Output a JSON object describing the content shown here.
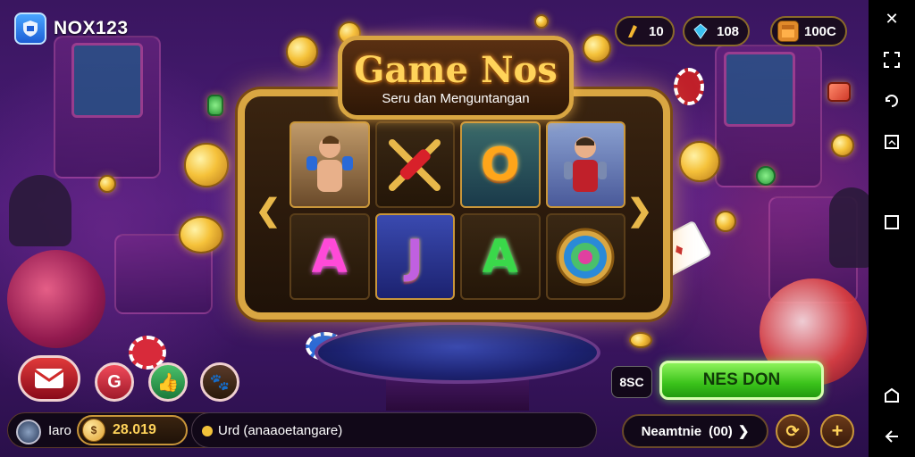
{
  "app": {
    "logo_text": "NOX123",
    "logo_icon": "shield-icon"
  },
  "currencies": [
    {
      "icon": "key-icon",
      "value": "10",
      "color": "#f2b531"
    },
    {
      "icon": "gem-icon",
      "value": "108",
      "color": "#3ac0f0"
    },
    {
      "icon": "chest-icon",
      "value": "100C",
      "color": "#e08a2a"
    }
  ],
  "game": {
    "title": "Game Nos",
    "subtitle": "Seru dan Menguntangan",
    "reels": [
      {
        "symbol": "hero-boxer-card",
        "text": ""
      },
      {
        "symbol": "crossed-bat-icon",
        "text": ""
      },
      {
        "symbol": "letter-o",
        "text": "O"
      },
      {
        "symbol": "hero-warrior-card",
        "text": ""
      },
      {
        "symbol": "letter-a-pink",
        "text": "A"
      },
      {
        "symbol": "letter-j",
        "text": "J"
      },
      {
        "symbol": "letter-a-green",
        "text": "A"
      },
      {
        "symbol": "compass-orb-icon",
        "text": ""
      }
    ],
    "arrow_left": "❮",
    "arrow_right": "❯"
  },
  "actions": {
    "play_label": "NES DON",
    "small_label": "8SC"
  },
  "player": {
    "name": "Iaro",
    "balance": "28.019",
    "ticker": "Urd (anaaoetangare)"
  },
  "leaderboard": {
    "label": "Neamtnie",
    "count": "(00)",
    "chevron": "❯"
  },
  "bottom_buttons": {
    "refresh_label": "⟳",
    "add_label": "+"
  }
}
